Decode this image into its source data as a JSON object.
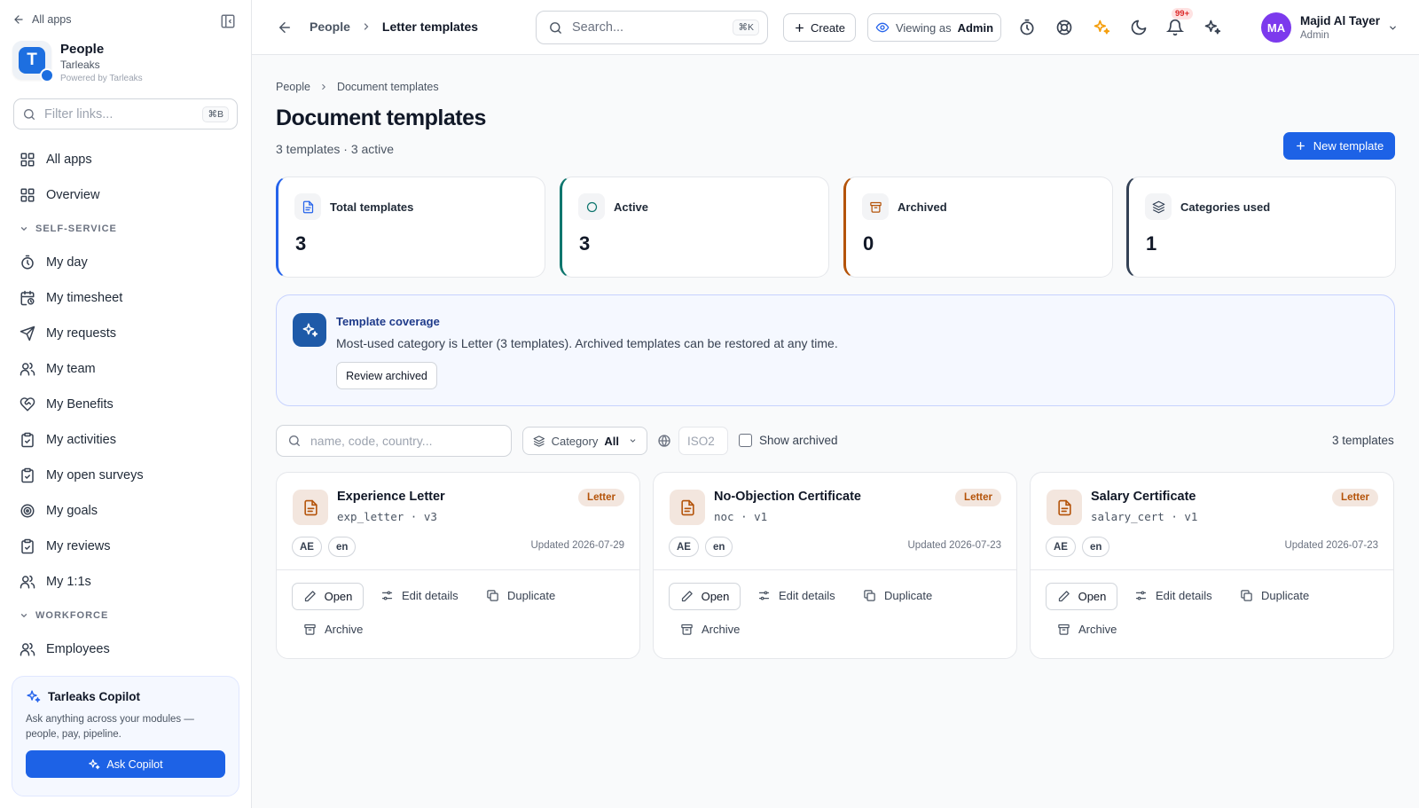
{
  "sidebar": {
    "back_label": "All apps",
    "brand": {
      "name": "People",
      "org": "Tarleaks",
      "powered": "Powered by Tarleaks",
      "logo_letter": "T"
    },
    "filter": {
      "placeholder": "Filter links...",
      "shortcut": "⌘B"
    },
    "items_top": [
      {
        "label": "All apps",
        "icon": "grid-icon"
      },
      {
        "label": "Overview",
        "icon": "grid-icon"
      }
    ],
    "section_self": "SELF-SERVICE",
    "items_self": [
      {
        "label": "My day",
        "icon": "stopwatch-icon"
      },
      {
        "label": "My timesheet",
        "icon": "calendar-clock-icon"
      },
      {
        "label": "My requests",
        "icon": "send-icon"
      },
      {
        "label": "My team",
        "icon": "users-icon"
      },
      {
        "label": "My Benefits",
        "icon": "heart-handshake-icon"
      },
      {
        "label": "My activities",
        "icon": "clipboard-check-icon"
      },
      {
        "label": "My open surveys",
        "icon": "clipboard-check-icon"
      },
      {
        "label": "My goals",
        "icon": "target-icon"
      },
      {
        "label": "My reviews",
        "icon": "clipboard-check-icon"
      },
      {
        "label": "My 1:1s",
        "icon": "users-icon"
      }
    ],
    "section_workforce": "WORKFORCE",
    "items_workforce": [
      {
        "label": "Employees",
        "icon": "users-icon"
      }
    ],
    "copilot": {
      "title": "Tarleaks Copilot",
      "desc": "Ask anything across your modules — people, pay, pipeline.",
      "button": "Ask Copilot"
    }
  },
  "topbar": {
    "crumb_root": "People",
    "crumb_current": "Letter templates",
    "search": {
      "placeholder": "Search...",
      "shortcut": "⌘K"
    },
    "create_label": "Create",
    "viewing_label": "Viewing as",
    "viewing_role": "Admin",
    "notifications_count": "99+",
    "user": {
      "initials": "MA",
      "name": "Majid Al Tayer",
      "role": "Admin"
    }
  },
  "page": {
    "crumb_root": "People",
    "crumb_current": "Document templates",
    "title": "Document templates",
    "subtitle": "3 templates · 3 active",
    "new_button": "New template"
  },
  "stats": [
    {
      "label": "Total templates",
      "value": "3",
      "accent": "#2563eb",
      "icon": "file-text-icon",
      "icon_color": "#2563eb"
    },
    {
      "label": "Active",
      "value": "3",
      "accent": "#0f766e",
      "icon": "circle-icon",
      "icon_color": "#0f766e"
    },
    {
      "label": "Archived",
      "value": "0",
      "accent": "#b45309",
      "icon": "archive-icon",
      "icon_color": "#b45309"
    },
    {
      "label": "Categories used",
      "value": "1",
      "accent": "#334155",
      "icon": "layers-icon",
      "icon_color": "#334155"
    }
  ],
  "coverage": {
    "title": "Template coverage",
    "desc": "Most-used category is Letter (3 templates). Archived templates can be restored at any time.",
    "button": "Review archived"
  },
  "filters": {
    "search_placeholder": "name, code, country...",
    "category_label": "Category",
    "category_value": "All",
    "iso_placeholder": "ISO2",
    "show_archived": "Show archived",
    "count": "3 templates"
  },
  "card_actions": {
    "open": "Open",
    "edit": "Edit details",
    "duplicate": "Duplicate",
    "archive": "Archive"
  },
  "templates": [
    {
      "name": "Experience Letter",
      "code": "exp_letter",
      "version": "v3",
      "category": "Letter",
      "country": "AE",
      "lang": "en",
      "updated": "Updated 2026-07-29"
    },
    {
      "name": "No-Objection Certificate",
      "code": "noc",
      "version": "v1",
      "category": "Letter",
      "country": "AE",
      "lang": "en",
      "updated": "Updated 2026-07-23"
    },
    {
      "name": "Salary Certificate",
      "code": "salary_cert",
      "version": "v1",
      "category": "Letter",
      "country": "AE",
      "lang": "en",
      "updated": "Updated 2026-07-23"
    }
  ]
}
